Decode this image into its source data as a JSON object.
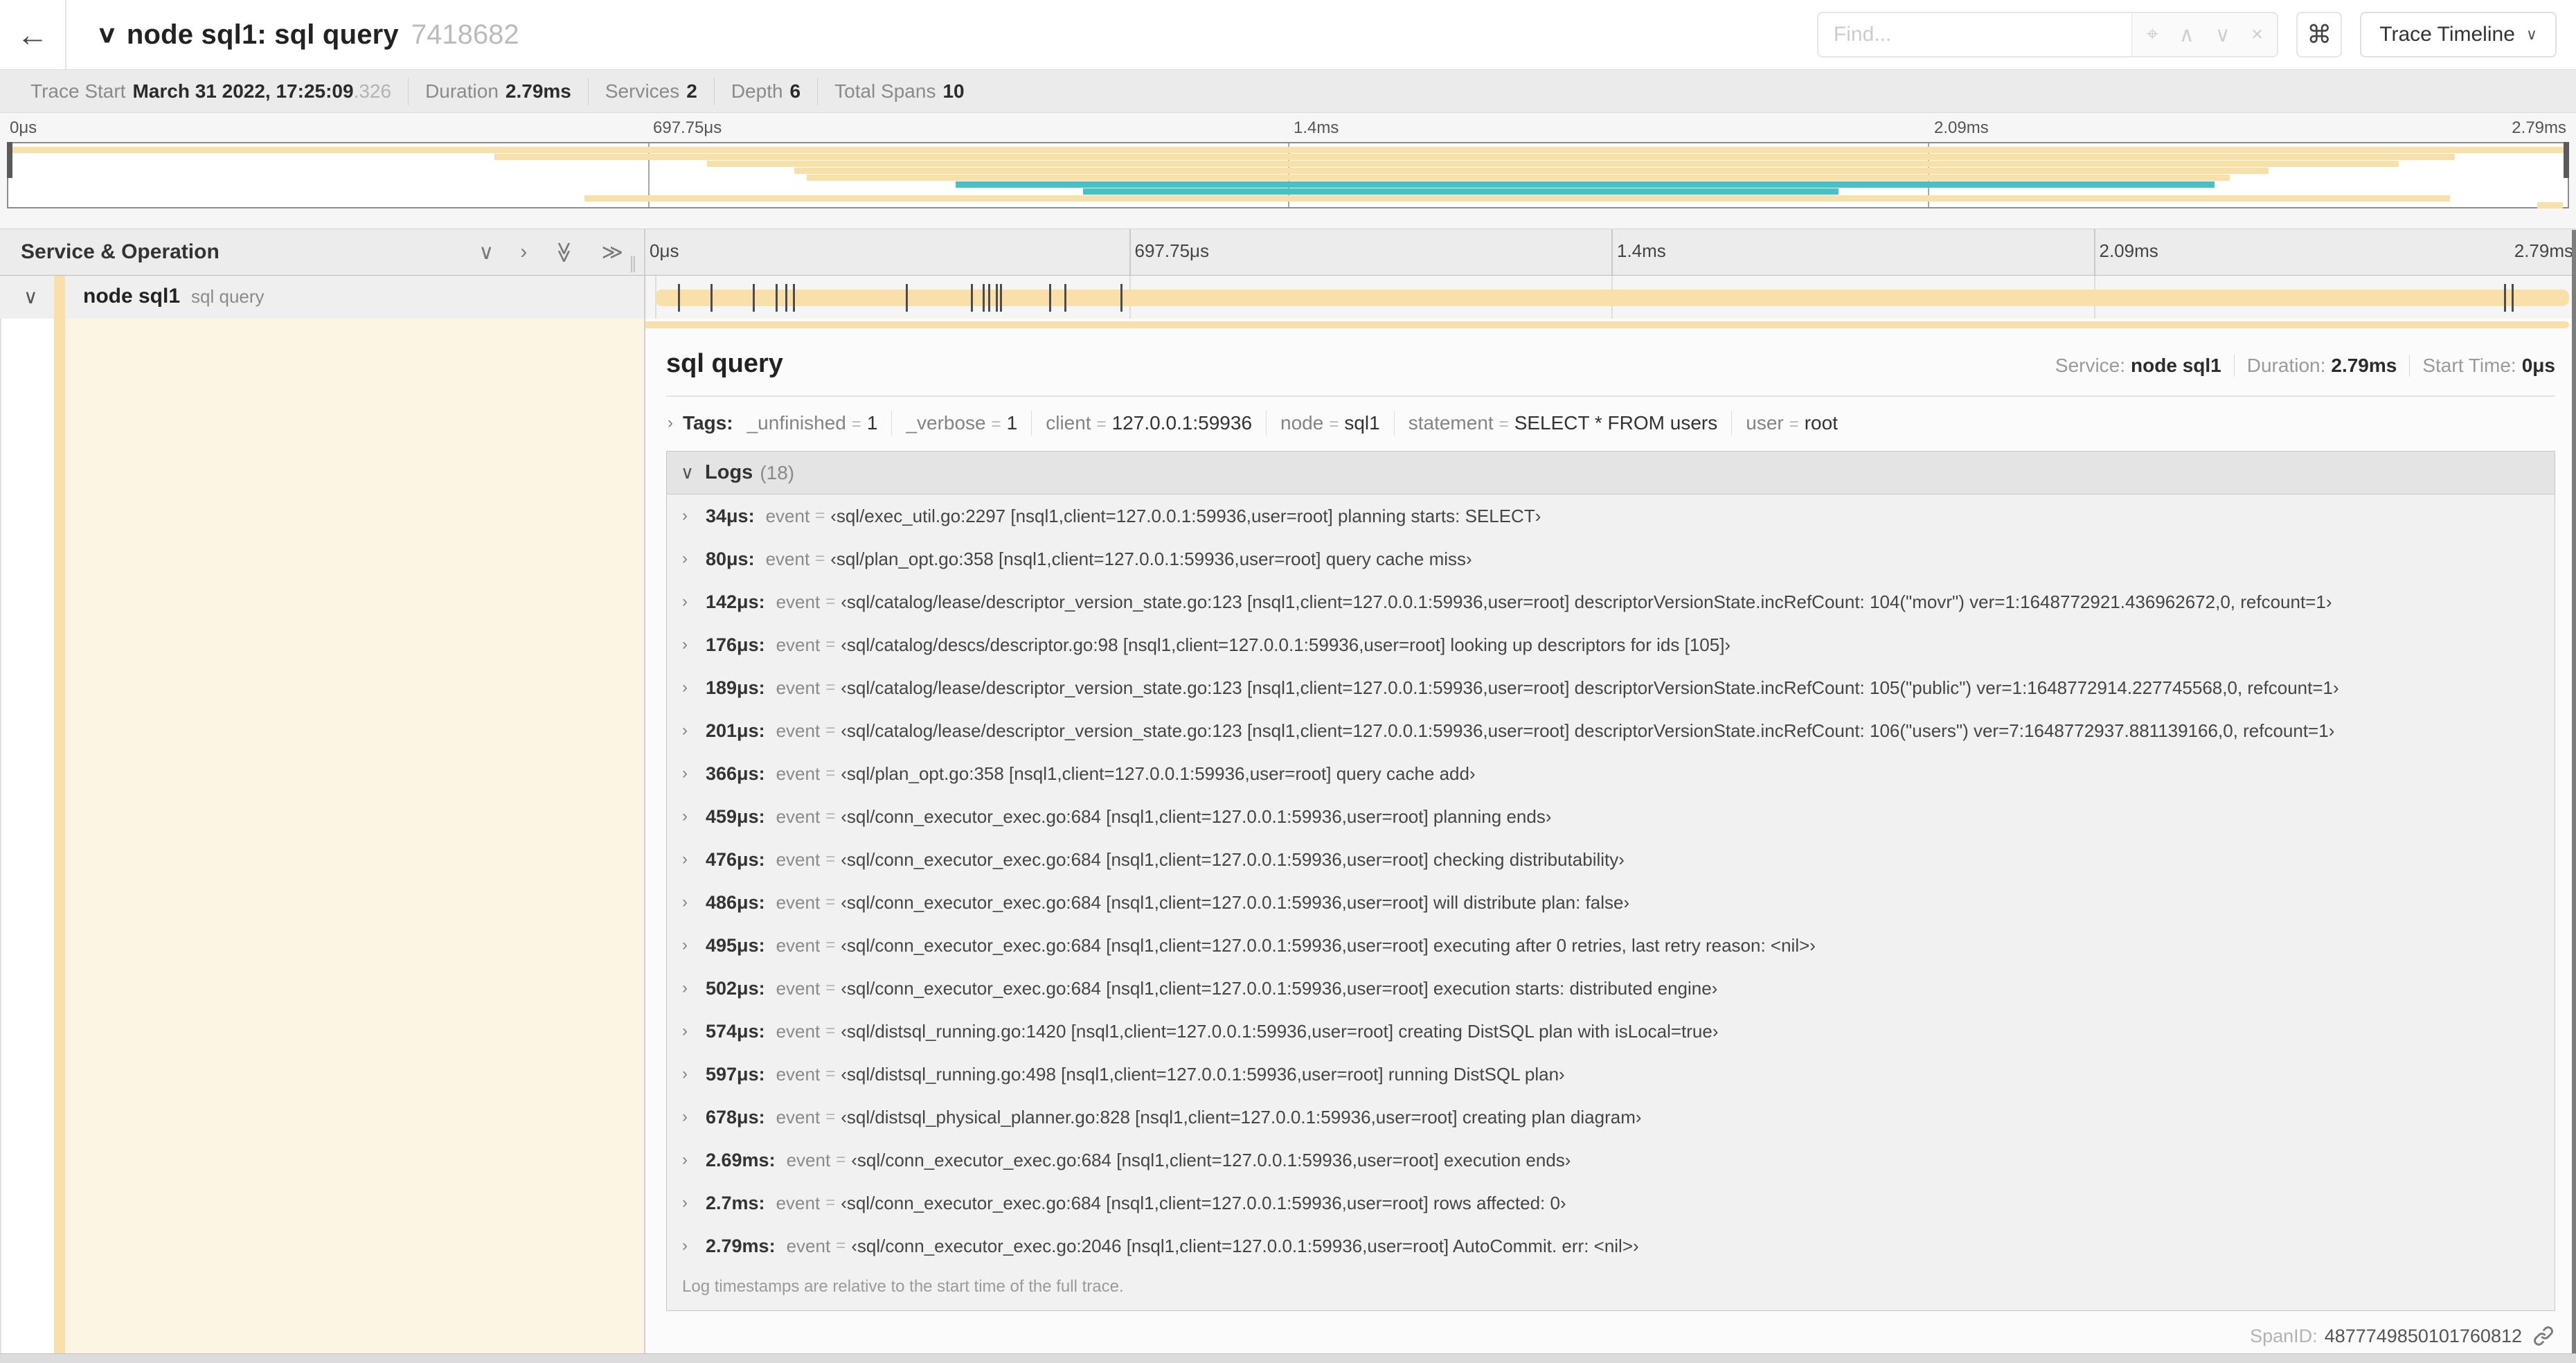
{
  "icons": {
    "back": "←",
    "collapse_one": "∨",
    "expand_one": "›",
    "double_chevron": "≫",
    "locate": "⌖",
    "prev": "∧",
    "next": "∨",
    "clear": "×",
    "shortcut": "⌘",
    "dropdown": "∨",
    "resizer": "∥",
    "chevron_down": "∨",
    "chevron_right": "›"
  },
  "header": {
    "title": "node sql1: sql query",
    "trace_id": "7418682",
    "find_placeholder": "Find...",
    "view_selector": "Trace Timeline"
  },
  "trace_info": {
    "items": [
      {
        "label": "Trace Start",
        "value": "March 31 2022, 17:25:09",
        "suffix": ".326"
      },
      {
        "label": "Duration",
        "value": "2.79ms",
        "suffix": ""
      },
      {
        "label": "Services",
        "value": "2",
        "suffix": ""
      },
      {
        "label": "Depth",
        "value": "6",
        "suffix": ""
      },
      {
        "label": "Total Spans",
        "value": "10",
        "suffix": ""
      }
    ]
  },
  "minimap": {
    "colors": {
      "tan": "#f8e0a8",
      "teal": "#45c2c5"
    },
    "spans": [
      {
        "start": 0,
        "end": 100,
        "color": "tan"
      },
      {
        "start": 19,
        "end": 95.6,
        "color": "tan"
      },
      {
        "start": 27.3,
        "end": 93.4,
        "color": "tan"
      },
      {
        "start": 30.7,
        "end": 88.3,
        "color": "tan"
      },
      {
        "start": 31.2,
        "end": 86.8,
        "color": "tan"
      },
      {
        "start": 37,
        "end": 86.2,
        "color": "teal"
      },
      {
        "start": 42,
        "end": 71.5,
        "color": "teal"
      },
      {
        "start": 22.5,
        "end": 95.4,
        "color": "tan"
      },
      {
        "start": 98.8,
        "end": 99.8,
        "color": "tan"
      }
    ]
  },
  "timeline": {
    "columns_title": "Service & Operation",
    "axis_ticks": [
      "0μs",
      "697.75μs",
      "1.4ms",
      "2.09ms",
      "2.79ms"
    ],
    "row": {
      "service": "node sql1",
      "operation": "sql query",
      "tick_percents": [
        1.2,
        2.9,
        5.1,
        6.3,
        6.8,
        7.2,
        13.1,
        16.5,
        17.1,
        17.4,
        17.8,
        18.0,
        20.6,
        21.4,
        24.3,
        96.6,
        97.0
      ]
    }
  },
  "detail": {
    "title": "sql query",
    "eq": "=",
    "overview": [
      {
        "label": "Service:",
        "value": "node sql1"
      },
      {
        "label": "Duration:",
        "value": "2.79ms"
      },
      {
        "label": "Start Time:",
        "value": "0μs"
      }
    ],
    "tags_label": "Tags:",
    "tags": [
      {
        "key": "_unfinished",
        "value": "1"
      },
      {
        "key": "_verbose",
        "value": "1"
      },
      {
        "key": "client",
        "value": "127.0.0.1:59936"
      },
      {
        "key": "node",
        "value": "sql1"
      },
      {
        "key": "statement",
        "value": "SELECT * FROM users"
      },
      {
        "key": "user",
        "value": "root"
      }
    ],
    "logs_title": "Logs",
    "logs_count": "(18)",
    "log_key": "event",
    "logs": [
      {
        "time": "34μs:",
        "value": "‹sql/exec_util.go:2297 [nsql1,client=127.0.0.1:59936,user=root] planning starts: SELECT›"
      },
      {
        "time": "80μs:",
        "value": "‹sql/plan_opt.go:358 [nsql1,client=127.0.0.1:59936,user=root] query cache miss›"
      },
      {
        "time": "142μs:",
        "value": "‹sql/catalog/lease/descriptor_version_state.go:123 [nsql1,client=127.0.0.1:59936,user=root] descriptorVersionState.incRefCount: 104(\"movr\") ver=1:1648772921.436962672,0, refcount=1›"
      },
      {
        "time": "176μs:",
        "value": "‹sql/catalog/descs/descriptor.go:98 [nsql1,client=127.0.0.1:59936,user=root] looking up descriptors for ids [105]›"
      },
      {
        "time": "189μs:",
        "value": "‹sql/catalog/lease/descriptor_version_state.go:123 [nsql1,client=127.0.0.1:59936,user=root] descriptorVersionState.incRefCount: 105(\"public\") ver=1:1648772914.227745568,0, refcount=1›"
      },
      {
        "time": "201μs:",
        "value": "‹sql/catalog/lease/descriptor_version_state.go:123 [nsql1,client=127.0.0.1:59936,user=root] descriptorVersionState.incRefCount: 106(\"users\") ver=7:1648772937.881139166,0, refcount=1›"
      },
      {
        "time": "366μs:",
        "value": "‹sql/plan_opt.go:358 [nsql1,client=127.0.0.1:59936,user=root] query cache add›"
      },
      {
        "time": "459μs:",
        "value": "‹sql/conn_executor_exec.go:684 [nsql1,client=127.0.0.1:59936,user=root] planning ends›"
      },
      {
        "time": "476μs:",
        "value": "‹sql/conn_executor_exec.go:684 [nsql1,client=127.0.0.1:59936,user=root] checking distributability›"
      },
      {
        "time": "486μs:",
        "value": "‹sql/conn_executor_exec.go:684 [nsql1,client=127.0.0.1:59936,user=root] will distribute plan: false›"
      },
      {
        "time": "495μs:",
        "value": "‹sql/conn_executor_exec.go:684 [nsql1,client=127.0.0.1:59936,user=root] executing after 0 retries, last retry reason: <nil>›"
      },
      {
        "time": "502μs:",
        "value": "‹sql/conn_executor_exec.go:684 [nsql1,client=127.0.0.1:59936,user=root] execution starts: distributed engine›"
      },
      {
        "time": "574μs:",
        "value": "‹sql/distsql_running.go:1420 [nsql1,client=127.0.0.1:59936,user=root] creating DistSQL plan with isLocal=true›"
      },
      {
        "time": "597μs:",
        "value": "‹sql/distsql_running.go:498 [nsql1,client=127.0.0.1:59936,user=root] running DistSQL plan›"
      },
      {
        "time": "678μs:",
        "value": "‹sql/distsql_physical_planner.go:828 [nsql1,client=127.0.0.1:59936,user=root] creating plan diagram›"
      },
      {
        "time": "2.69ms:",
        "value": "‹sql/conn_executor_exec.go:684 [nsql1,client=127.0.0.1:59936,user=root] execution ends›"
      },
      {
        "time": "2.7ms:",
        "value": "‹sql/conn_executor_exec.go:684 [nsql1,client=127.0.0.1:59936,user=root] rows affected: 0›"
      },
      {
        "time": "2.79ms:",
        "value": "‹sql/conn_executor_exec.go:2046 [nsql1,client=127.0.0.1:59936,user=root] AutoCommit. err: <nil>›"
      }
    ],
    "logs_note": "Log timestamps are relative to the start time of the full trace.",
    "spanid_label": "SpanID:",
    "spanid_value": "4877749850101760812"
  }
}
